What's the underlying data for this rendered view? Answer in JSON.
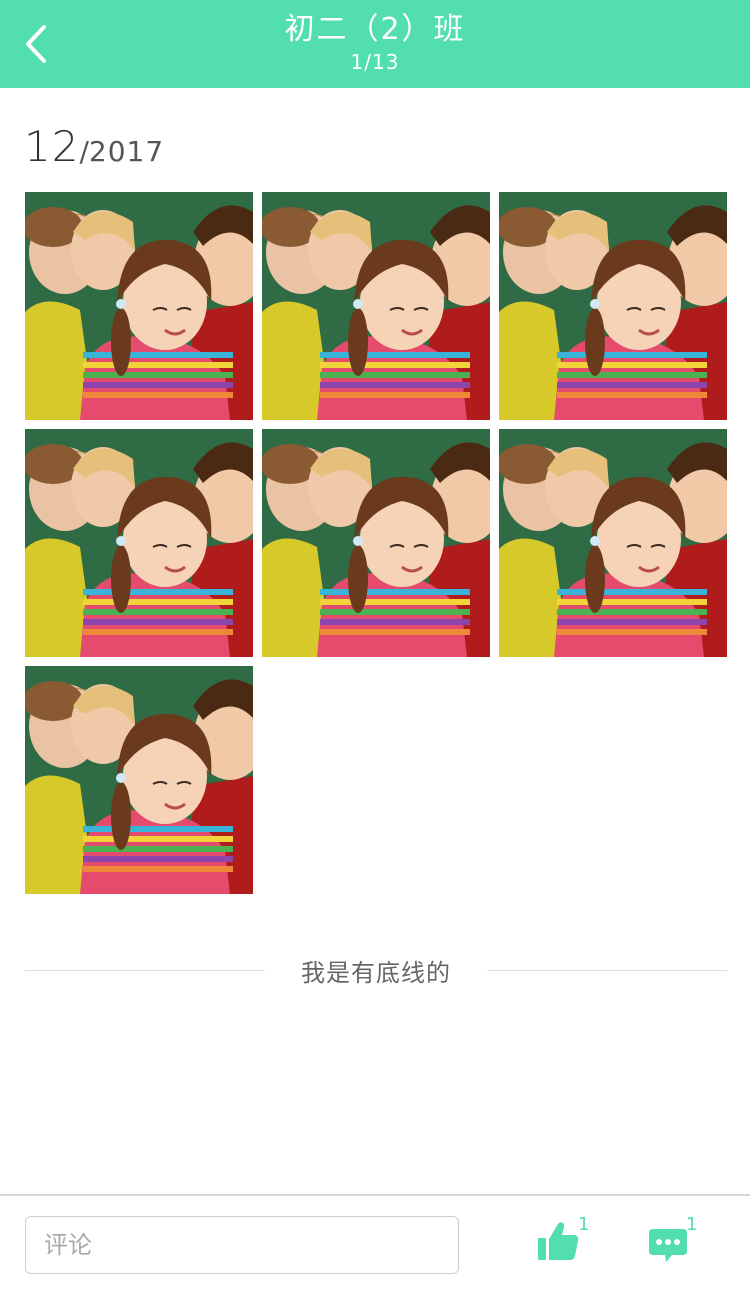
{
  "header": {
    "title": "初二（2）班",
    "subtitle": "1/13",
    "back_icon": "chevron-left-icon"
  },
  "date": {
    "day": "12",
    "separator": "/",
    "year": "2017"
  },
  "photos": [
    {
      "alt": "children reading together"
    },
    {
      "alt": "children reading together"
    },
    {
      "alt": "children reading together"
    },
    {
      "alt": "children reading together"
    },
    {
      "alt": "children reading together"
    },
    {
      "alt": "children reading together"
    },
    {
      "alt": "children reading together"
    }
  ],
  "footer_note": "我是有底线的",
  "footer": {
    "comment_placeholder": "评论",
    "like_count": "1",
    "comment_count": "1",
    "like_icon": "thumbs-up-icon",
    "comment_icon": "chat-bubble-icon"
  },
  "colors": {
    "accent": "#52dfad"
  }
}
